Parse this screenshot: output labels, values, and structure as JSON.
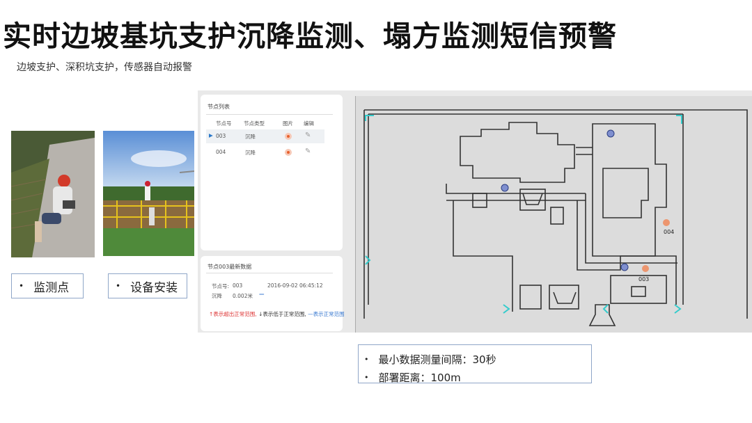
{
  "slide": {
    "title": "实时边坡基坑支护沉降监测、塌方监测短信预警",
    "subtitle": "边坡支护、深积坑支护，传感器自动报警"
  },
  "photos": {
    "label_1": "监测点",
    "label_2": "设备安装",
    "bullet": "•"
  },
  "node_list": {
    "title": "节点列表",
    "headers": [
      "节点号",
      "节点类型",
      "图片",
      "编辑"
    ],
    "rows": [
      {
        "id": "003",
        "type": "沉降"
      },
      {
        "id": "004",
        "type": "沉降"
      }
    ]
  },
  "latest_data": {
    "title": "节点003最新数据",
    "node_label": "节点号:",
    "node_value": "003",
    "timestamp": "2016-09-02 06:45:12",
    "settle_label": "沉降",
    "settle_value": "0.002米",
    "legend_up": "↑表示超出正常范围,",
    "legend_down": "↓表示低于正常范围,",
    "legend_normal": "—表示正常范围"
  },
  "map": {
    "marker_003": "003",
    "marker_004": "004",
    "accent_marker": "#f08a5c",
    "blue_marker": "#7f8fcf",
    "sensor_color": "#33cccc"
  },
  "info": {
    "interval": "最小数据测量间隔：30秒",
    "distance": "部署距离：100m",
    "bullet": "•"
  }
}
